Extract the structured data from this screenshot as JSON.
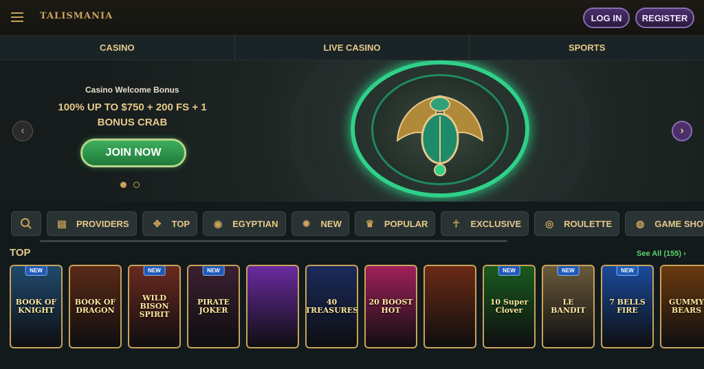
{
  "header": {
    "logo": "TALISMANIA",
    "login_label": "LOG IN",
    "register_label": "REGISTER"
  },
  "nav": {
    "tabs": [
      {
        "label": "CASINO"
      },
      {
        "label": "LIVE CASINO"
      },
      {
        "label": "SPORTS"
      }
    ]
  },
  "hero": {
    "subtitle": "Casino Welcome Bonus",
    "title": "100% UP TO $750 + 200 FS + 1 BONUS CRAB",
    "cta_label": "JOIN NOW",
    "slide_count": 2,
    "active_slide": 1,
    "prev_icon": "chevron-left-icon",
    "next_icon": "chevron-right-icon"
  },
  "categories": [
    {
      "label": "",
      "icon": "search-icon"
    },
    {
      "label": "PROVIDERS",
      "icon": "providers-icon"
    },
    {
      "label": "TOP",
      "icon": "scarab-icon"
    },
    {
      "label": "EGYPTIAN",
      "icon": "eye-of-horus-icon"
    },
    {
      "label": "NEW",
      "icon": "sun-icon"
    },
    {
      "label": "POPULAR",
      "icon": "crown-icon"
    },
    {
      "label": "EXCLUSIVE",
      "icon": "pharaoh-icon"
    },
    {
      "label": "ROULETTE",
      "icon": "roulette-icon"
    },
    {
      "label": "GAME SHOWS",
      "icon": "game-shows-icon"
    }
  ],
  "top_section": {
    "title": "TOP",
    "see_all_label": "See All (155)",
    "games": [
      {
        "name": "BOOK OF KNIGHT",
        "badge": "NEW",
        "bg": "#1f4a6e"
      },
      {
        "name": "BOOK OF DRAGON",
        "badge": "",
        "bg": "#5a2a18"
      },
      {
        "name": "WILD BISON SPIRIT",
        "badge": "NEW",
        "bg": "#6a2a20"
      },
      {
        "name": "PIRATE JOKER",
        "badge": "NEW",
        "bg": "#3a2030"
      },
      {
        "name": "",
        "badge": "",
        "bg": "#6a2aa0"
      },
      {
        "name": "40 TREASURES",
        "badge": "",
        "bg": "#1a2a5a"
      },
      {
        "name": "20 BOOST HOT",
        "badge": "",
        "bg": "#a0205a"
      },
      {
        "name": "",
        "badge": "",
        "bg": "#6a2a14"
      },
      {
        "name": "10 Super Clover",
        "badge": "NEW",
        "bg": "#1a5a1e"
      },
      {
        "name": "LE BANDIT",
        "badge": "NEW",
        "bg": "#6a5a3a"
      },
      {
        "name": "7 BELLS FIRE",
        "badge": "NEW",
        "bg": "#1a4a9a"
      },
      {
        "name": "GUMMY BEARS",
        "badge": "",
        "bg": "#6a3a10"
      }
    ]
  },
  "colors": {
    "accent": "#c9a35a",
    "cta": "#2e9a4e",
    "auth": "#4a2f6a",
    "see_all": "#5bd46a"
  }
}
